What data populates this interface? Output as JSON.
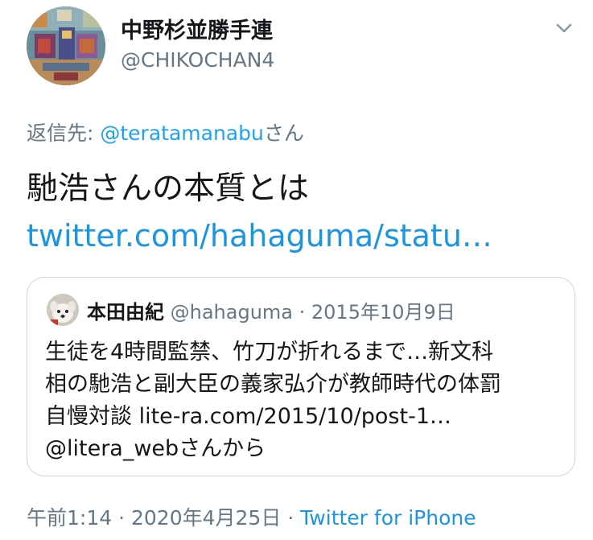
{
  "author": {
    "display_name": "中野杉並勝手連",
    "handle": "@CHIKOCHAN4"
  },
  "reply": {
    "prefix": "返信先: ",
    "mention": "@teratamanabu",
    "suffix": "さん"
  },
  "tweet": {
    "text": "馳浩さんの本質とは",
    "link": "twitter.com/hahaguma/statu…"
  },
  "quoted": {
    "name": "本田由紀",
    "meta": "@hahaguma · 2015年10月9日",
    "lines": [
      "生徒を4時間監禁、竹刀が折れるまで…新文科",
      "相の馳浩と副大臣の義家弘介が教師時代の体罰",
      "自慢対談 lite-ra.com/2015/10/post-1…",
      "@litera_webさんから"
    ]
  },
  "footer": {
    "time": "午前1:14",
    "separator": " · ",
    "date": "2020年4月25日",
    "source": "Twitter for iPhone"
  },
  "icons": {
    "menu": "chevron-down-icon"
  },
  "colors": {
    "link": "#1b95e0",
    "muted": "#657786",
    "text": "#14171a",
    "border": "#ccd6dd"
  }
}
